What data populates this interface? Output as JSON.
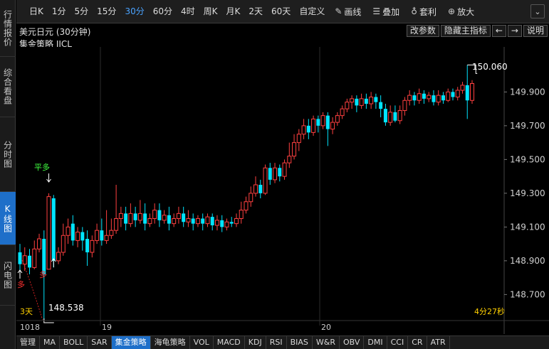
{
  "left_tabs": [
    {
      "label": "行情报价",
      "active": false
    },
    {
      "label": "综合看盘",
      "active": false
    },
    {
      "label": "分时图",
      "active": false
    },
    {
      "label": "K线图",
      "active": true
    },
    {
      "label": "闪电图",
      "active": false
    }
  ],
  "toolbar": {
    "periods": [
      "日K",
      "1分",
      "5分",
      "15分",
      "30分",
      "60分",
      "4时",
      "周K",
      "月K",
      "2天",
      "60天",
      "自定义"
    ],
    "active_period": "30分",
    "draw_label": "画线",
    "overlay_label": "叠加",
    "template_label": "套利",
    "zoom_label": "放大"
  },
  "info": {
    "title": "美元日元 (30分钟)",
    "indicator": "集金策略 JJCL",
    "buttons": [
      "改参数",
      "隐藏主指标",
      "←",
      "→",
      "说明"
    ]
  },
  "chart_data": {
    "type": "candlestick",
    "up_color": "#ff4040",
    "down_color": "#00e5ff",
    "ylim": [
      148.5,
      150.2
    ],
    "y_ticks": [
      "149.900",
      "149.700",
      "149.500",
      "149.300",
      "149.100",
      "148.900",
      "148.700"
    ],
    "x_labels": [
      "1018",
      "19",
      "20"
    ],
    "high_label": "150.060",
    "low_label": "148.538",
    "low_note": "3天",
    "signal_flat": "平多",
    "signal_long": "多",
    "signal_long2": "多",
    "countdown": "4分27秒",
    "candles": [
      [
        148.95,
        148.88,
        149.0,
        148.8
      ],
      [
        148.88,
        148.93,
        148.98,
        148.84
      ],
      [
        148.93,
        148.86,
        148.97,
        148.82
      ],
      [
        148.86,
        148.97,
        149.02,
        148.85
      ],
      [
        148.97,
        149.03,
        149.06,
        148.95
      ],
      [
        149.03,
        148.82,
        149.08,
        148.55
      ],
      [
        148.85,
        149.28,
        149.3,
        148.85
      ],
      [
        149.27,
        148.9,
        149.29,
        148.86
      ],
      [
        148.9,
        148.95,
        148.98,
        148.88
      ],
      [
        148.95,
        149.05,
        149.12,
        148.93
      ],
      [
        149.05,
        149.1,
        149.15,
        149.0
      ],
      [
        149.12,
        149.02,
        149.17,
        148.99
      ],
      [
        149.02,
        149.07,
        149.1,
        148.98
      ],
      [
        149.07,
        149.02,
        149.1,
        148.96
      ],
      [
        149.03,
        148.95,
        149.08,
        148.87
      ],
      [
        148.95,
        149.02,
        149.05,
        148.92
      ],
      [
        149.02,
        149.08,
        149.12,
        149.0
      ],
      [
        149.08,
        149.02,
        149.15,
        148.99
      ],
      [
        149.02,
        149.05,
        149.2,
        149.0
      ],
      [
        149.05,
        149.08,
        149.15,
        149.03
      ],
      [
        149.08,
        149.15,
        149.35,
        149.06
      ],
      [
        149.15,
        149.18,
        149.22,
        149.1
      ],
      [
        149.18,
        149.12,
        149.22,
        149.08
      ],
      [
        149.12,
        149.18,
        149.24,
        149.1
      ],
      [
        149.18,
        149.14,
        149.22,
        149.1
      ],
      [
        149.14,
        149.18,
        149.26,
        149.12
      ],
      [
        149.18,
        149.12,
        149.24,
        149.08
      ],
      [
        149.12,
        149.15,
        149.18,
        149.1
      ],
      [
        149.15,
        149.2,
        149.24,
        149.12
      ],
      [
        149.2,
        149.14,
        149.24,
        149.1
      ],
      [
        149.14,
        149.17,
        149.2,
        149.12
      ],
      [
        149.17,
        149.12,
        149.22,
        149.08
      ],
      [
        149.12,
        149.15,
        149.18,
        149.1
      ],
      [
        149.15,
        149.18,
        149.22,
        149.12
      ],
      [
        149.18,
        149.13,
        149.22,
        149.1
      ],
      [
        149.13,
        149.15,
        149.2,
        149.1
      ],
      [
        149.15,
        149.12,
        149.18,
        149.08
      ],
      [
        149.12,
        149.15,
        149.17,
        149.1
      ],
      [
        149.15,
        149.12,
        149.18,
        149.08
      ],
      [
        149.12,
        149.16,
        149.18,
        149.1
      ],
      [
        149.16,
        149.11,
        149.18,
        149.08
      ],
      [
        149.11,
        149.14,
        149.17,
        149.08
      ],
      [
        149.14,
        149.1,
        149.17,
        149.07
      ],
      [
        149.1,
        149.13,
        149.15,
        149.08
      ],
      [
        149.13,
        149.12,
        149.16,
        149.1
      ],
      [
        149.12,
        149.15,
        149.18,
        149.1
      ],
      [
        149.15,
        149.2,
        149.25,
        149.12
      ],
      [
        149.2,
        149.25,
        149.28,
        149.18
      ],
      [
        149.25,
        149.3,
        149.34,
        149.22
      ],
      [
        149.3,
        149.35,
        149.4,
        149.28
      ],
      [
        149.35,
        149.3,
        149.38,
        149.27
      ],
      [
        149.3,
        149.45,
        149.47,
        149.29
      ],
      [
        149.45,
        149.38,
        149.48,
        149.35
      ],
      [
        149.38,
        149.45,
        149.48,
        149.36
      ],
      [
        149.45,
        149.4,
        149.47,
        149.37
      ],
      [
        149.4,
        149.48,
        149.5,
        149.38
      ],
      [
        149.48,
        149.52,
        149.6,
        149.45
      ],
      [
        149.52,
        149.6,
        149.65,
        149.5
      ],
      [
        149.6,
        149.65,
        149.68,
        149.55
      ],
      [
        149.65,
        149.7,
        149.74,
        149.62
      ],
      [
        149.7,
        149.66,
        149.74,
        149.62
      ],
      [
        149.66,
        149.74,
        149.76,
        149.64
      ],
      [
        149.74,
        149.7,
        149.76,
        149.66
      ],
      [
        149.7,
        149.76,
        149.78,
        149.68
      ],
      [
        149.76,
        149.68,
        149.78,
        149.58
      ],
      [
        149.68,
        149.72,
        149.75,
        149.65
      ],
      [
        149.72,
        149.76,
        149.78,
        149.7
      ],
      [
        149.76,
        149.8,
        149.82,
        149.74
      ],
      [
        149.8,
        149.84,
        149.86,
        149.78
      ],
      [
        149.84,
        149.86,
        149.88,
        149.8
      ],
      [
        149.86,
        149.82,
        149.88,
        149.78
      ],
      [
        149.82,
        149.86,
        149.89,
        149.8
      ],
      [
        149.86,
        149.83,
        149.89,
        149.8
      ],
      [
        149.83,
        149.87,
        149.9,
        149.8
      ],
      [
        149.87,
        149.84,
        149.89,
        149.8
      ],
      [
        149.84,
        149.8,
        149.88,
        149.75
      ],
      [
        149.8,
        149.72,
        149.83,
        149.7
      ],
      [
        149.72,
        149.78,
        149.82,
        149.7
      ],
      [
        149.78,
        149.73,
        149.82,
        149.72
      ],
      [
        149.73,
        149.79,
        149.82,
        149.71
      ],
      [
        149.79,
        149.85,
        149.87,
        149.76
      ],
      [
        149.85,
        149.88,
        149.91,
        149.82
      ],
      [
        149.88,
        149.85,
        149.9,
        149.82
      ],
      [
        149.85,
        149.89,
        149.92,
        149.83
      ],
      [
        149.89,
        149.86,
        149.91,
        149.83
      ],
      [
        149.86,
        149.88,
        149.9,
        149.84
      ],
      [
        149.88,
        149.84,
        149.91,
        149.82
      ],
      [
        149.84,
        149.88,
        149.91,
        149.82
      ],
      [
        149.88,
        149.85,
        149.9,
        149.83
      ],
      [
        149.85,
        149.9,
        149.92,
        149.84
      ],
      [
        149.9,
        149.87,
        149.92,
        149.85
      ],
      [
        149.87,
        149.91,
        149.93,
        149.85
      ],
      [
        149.91,
        149.94,
        149.96,
        149.89
      ],
      [
        149.94,
        149.85,
        150.06,
        149.74
      ],
      [
        149.85,
        149.95,
        149.97,
        149.83
      ]
    ]
  },
  "bottom_tabs": [
    {
      "label": "管理",
      "active": false
    },
    {
      "label": "MA",
      "active": false
    },
    {
      "label": "BOLL",
      "active": false
    },
    {
      "label": "SAR",
      "active": false
    },
    {
      "label": "集金策略",
      "active": true
    },
    {
      "label": "海龟策略",
      "active": false
    },
    {
      "label": "VOL",
      "active": false
    },
    {
      "label": "MACD",
      "active": false
    },
    {
      "label": "KDJ",
      "active": false
    },
    {
      "label": "RSI",
      "active": false
    },
    {
      "label": "BIAS",
      "active": false
    },
    {
      "label": "W&R",
      "active": false
    },
    {
      "label": "OBV",
      "active": false
    },
    {
      "label": "DMI",
      "active": false
    },
    {
      "label": "CCI",
      "active": false
    },
    {
      "label": "CR",
      "active": false
    },
    {
      "label": "ATR",
      "active": false
    }
  ]
}
